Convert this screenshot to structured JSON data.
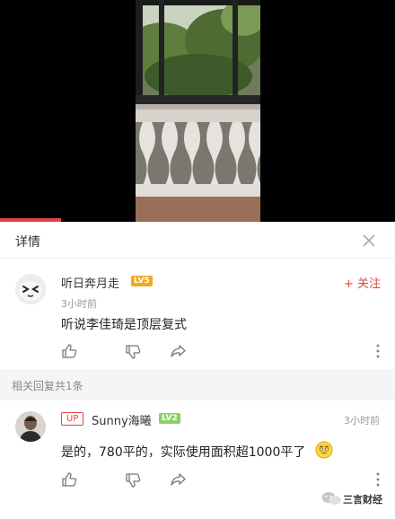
{
  "panel": {
    "title": "详情"
  },
  "main_comment": {
    "username": "听日奔月走",
    "level": "LV5",
    "time": "3小时前",
    "text": "听说李佳琦是顶层复式",
    "follow_label": "+ 关注"
  },
  "replies_section": {
    "label": "相关回复共1条"
  },
  "reply": {
    "up_badge": "UP",
    "username": "Sunny海曦",
    "level": "LV2",
    "time": "3小时前",
    "text": "是的，780平的，实际使用面积超1000平了"
  },
  "watermark": {
    "brand": "三言财经"
  },
  "colors": {
    "accent": "#e64340",
    "level5": "#f5a623",
    "level2": "#8bd06a"
  },
  "icons": [
    "close-icon",
    "like-icon",
    "dislike-icon",
    "share-icon",
    "more-icon",
    "emoji-icon"
  ]
}
